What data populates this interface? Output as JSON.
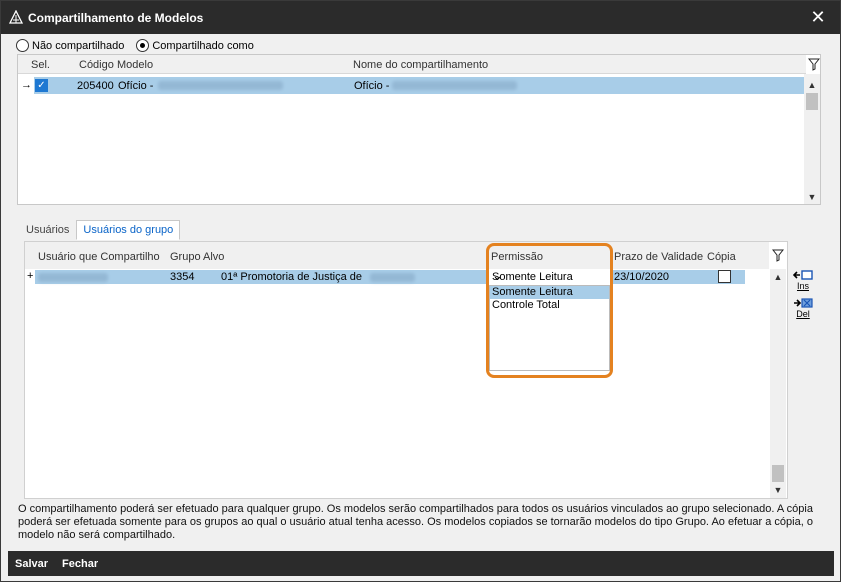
{
  "window": {
    "title": "Compartilhamento de Modelos"
  },
  "share_options": {
    "not_shared": "Não compartilhado",
    "shared_as": "Compartilhado como",
    "selected": "shared_as"
  },
  "models_grid": {
    "columns": [
      "Sel.",
      "Código",
      "Modelo",
      "Nome do compartilhamento"
    ],
    "rows": [
      {
        "selected": true,
        "code": "205400",
        "model": "Ofício -",
        "share_name": "Ofício -"
      }
    ]
  },
  "tabs": [
    {
      "label": "Usuários",
      "active": false
    },
    {
      "label": "Usuários do grupo",
      "active": true
    }
  ],
  "group_grid": {
    "columns": [
      "Usuário que Compartilho",
      "Grupo Alvo",
      "Permissão",
      "Prazo de Validade",
      "Cópia"
    ],
    "rows": [
      {
        "group_id": "3354",
        "group_name": "01ª Promotoria de Justiça de",
        "permission": "Somente Leitura",
        "validity": "23/10/2020",
        "copy": false
      }
    ]
  },
  "permission_options": [
    "Somente Leitura",
    "Controle Total"
  ],
  "side_actions": {
    "insert": "Ins",
    "delete": "Del"
  },
  "info_text": "O compartilhamento poderá ser efetuado para qualquer grupo. Os modelos serão compartilhados para todos os usuários vinculados ao grupo selecionado. A cópia poderá ser efetuada somente para os grupos ao qual o usuário atual tenha acesso. Os modelos copiados se tornarão modelos do tipo Grupo. Ao efetuar a cópia, o modelo não será compartilhado.",
  "footer": {
    "save": "Salvar",
    "close": "Fechar"
  },
  "colors": {
    "selection": "#a8cde8",
    "accent": "#0a64c8",
    "highlight": "#e48220",
    "chrome": "#2b2b2b"
  }
}
